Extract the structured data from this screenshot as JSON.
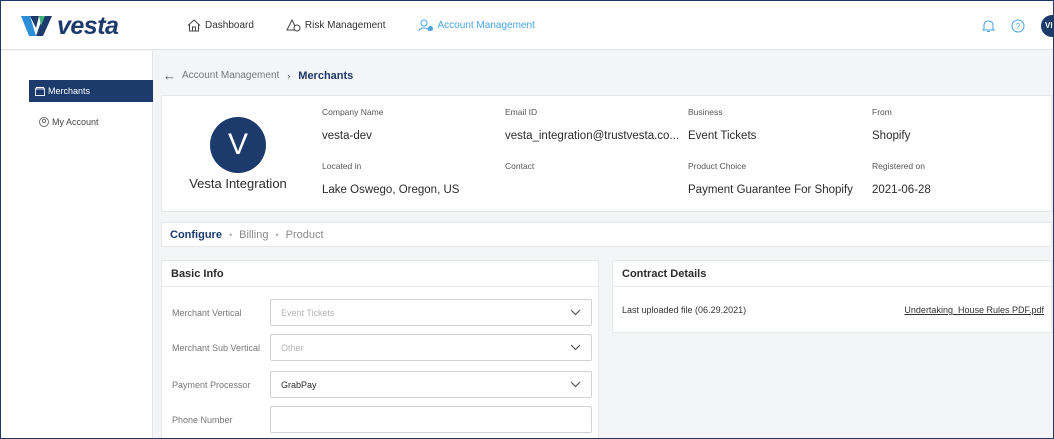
{
  "app": {
    "logo_text": "vesta"
  },
  "nav": [
    {
      "label": "Dashboard"
    },
    {
      "label": "Risk Management"
    },
    {
      "label": "Account Management"
    }
  ],
  "user": {
    "initials": "VI"
  },
  "sidebar": {
    "items": [
      {
        "label": "Merchants"
      },
      {
        "label": "My Account"
      }
    ]
  },
  "breadcrumb": {
    "parent": "Account Management",
    "separator": "›",
    "current": "Merchants"
  },
  "merchant": {
    "avatar_letter": "V",
    "name": "Vesta Integration",
    "fields": {
      "company_name": {
        "label": "Company Name",
        "value": "vesta-dev"
      },
      "email": {
        "label": "Email ID",
        "value": "vesta_integration@trustvesta.co..."
      },
      "business": {
        "label": "Business",
        "value": "Event Tickets"
      },
      "from": {
        "label": "From",
        "value": "Shopify"
      },
      "located_in": {
        "label": "Located in",
        "value": "Lake Oswego, Oregon, US"
      },
      "contact": {
        "label": "Contact",
        "value": ""
      },
      "product_choice": {
        "label": "Product Choice",
        "value": "Payment Guarantee For Shopify"
      },
      "registered_on": {
        "label": "Registered on",
        "value": "2021-06-28"
      }
    }
  },
  "tabs": [
    {
      "label": "Configure"
    },
    {
      "label": "Billing"
    },
    {
      "label": "Product"
    }
  ],
  "basic_info": {
    "title": "Basic Info",
    "merchant_vertical": {
      "label": "Merchant Vertical",
      "value": "Event Tickets"
    },
    "merchant_sub_vertical": {
      "label": "Merchant Sub Vertical",
      "value": "Other"
    },
    "payment_processor": {
      "label": "Payment Processor",
      "value": "GrabPay"
    },
    "phone_number": {
      "label": "Phone Number",
      "value": ""
    }
  },
  "contract": {
    "title": "Contract Details",
    "last_uploaded": "Last uploaded file (06.29.2021)",
    "file_name": "Undertaking_House Rules PDF.pdf"
  },
  "colors": {
    "brand_navy": "#1c3a6b",
    "accent_blue": "#4aa3df"
  }
}
